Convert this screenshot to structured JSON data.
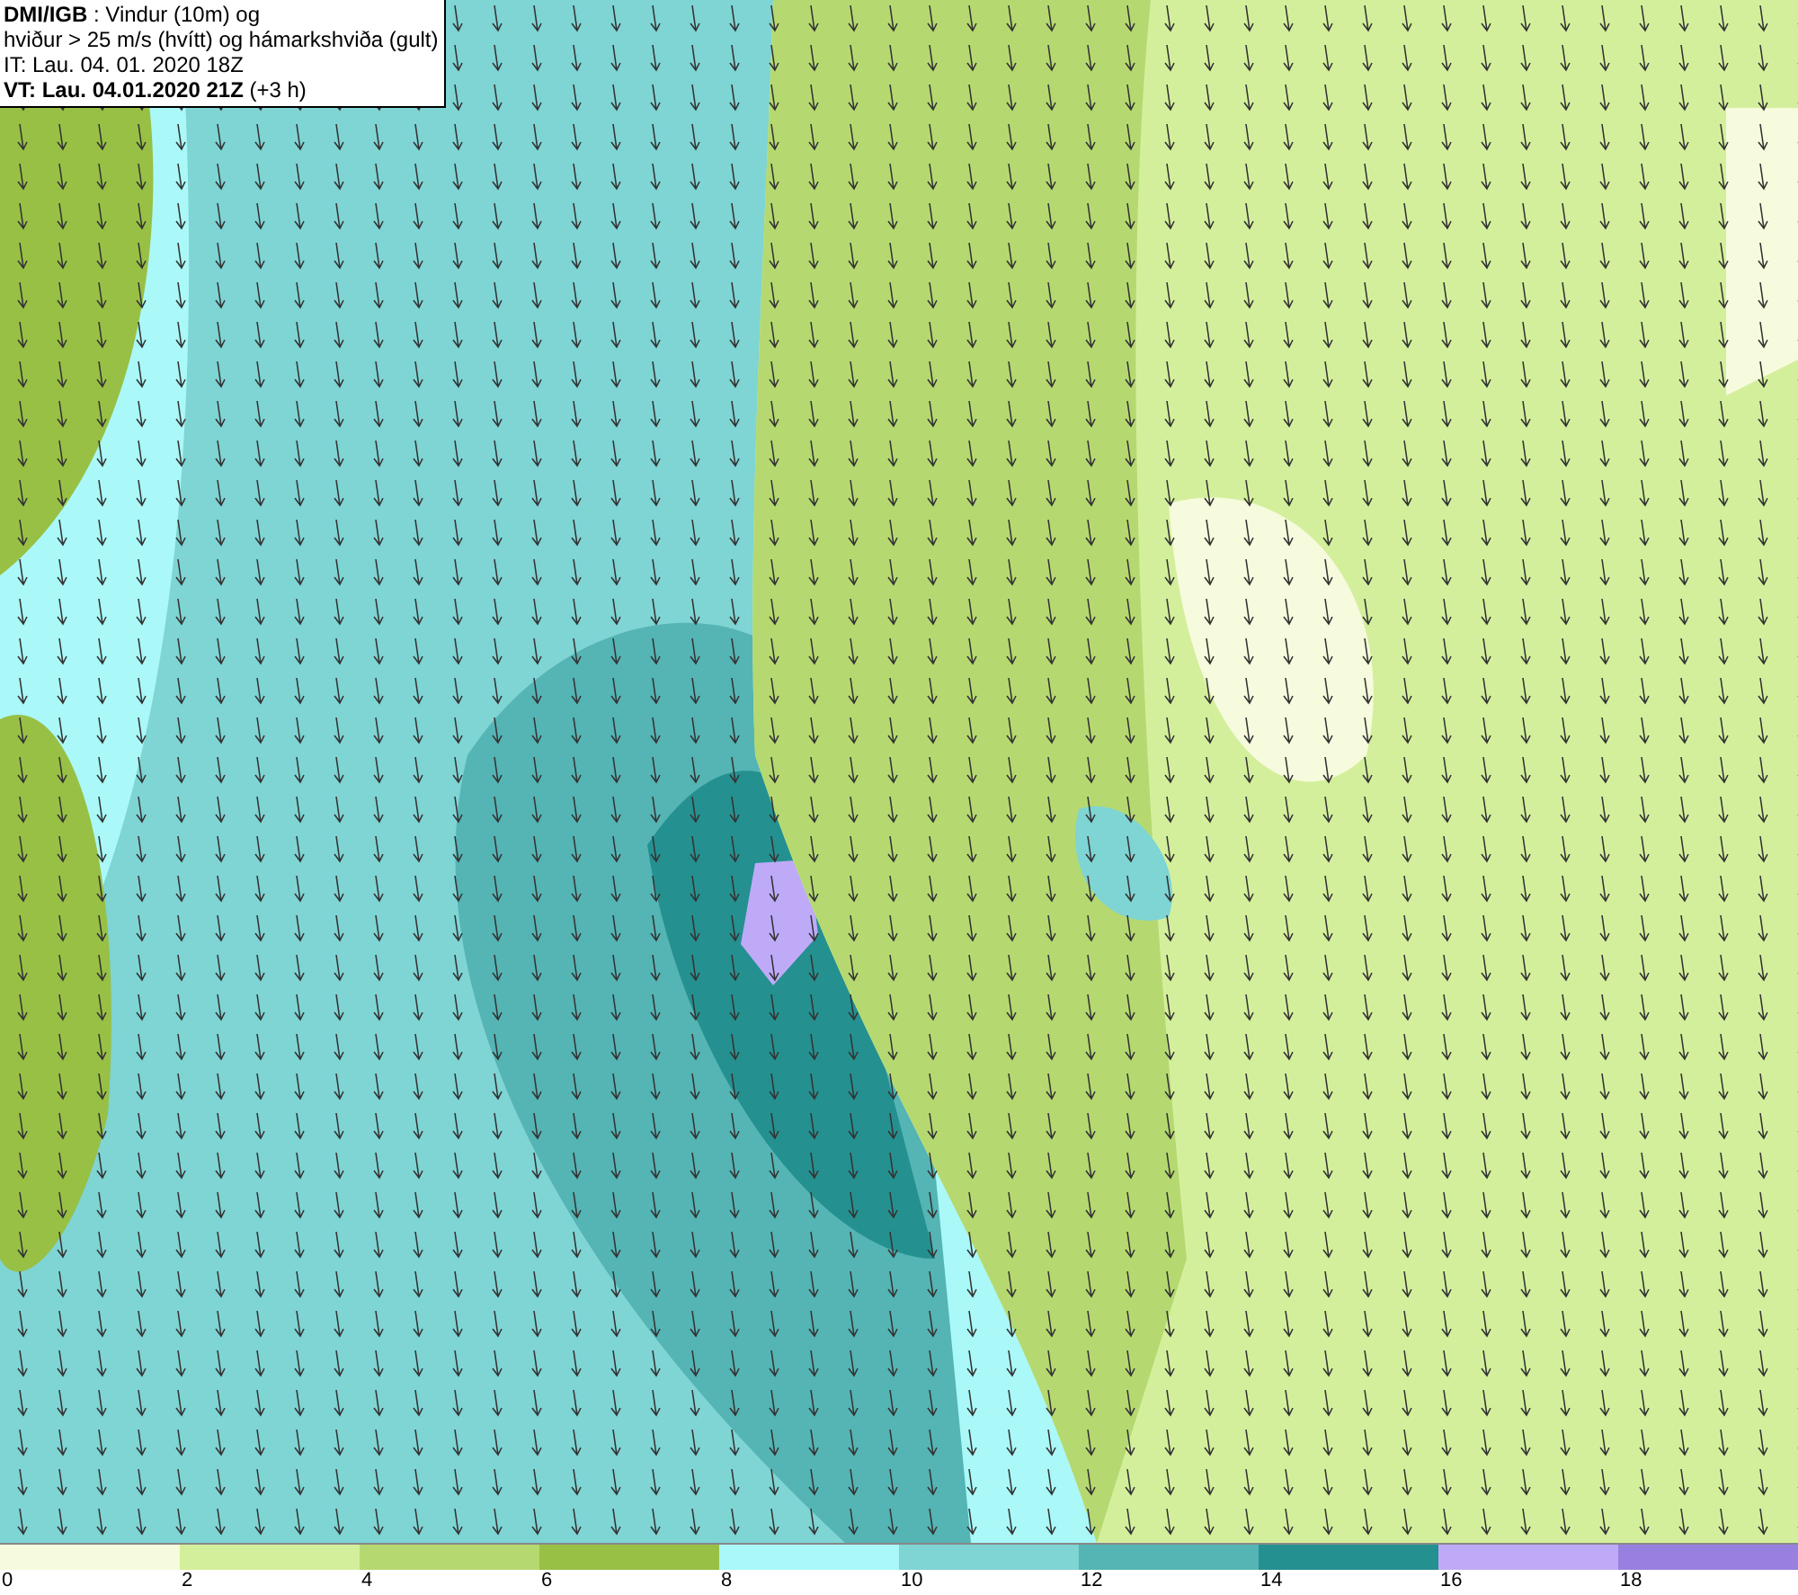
{
  "info_box": {
    "lines": [
      "**DMI/IGB** : Vindur (10m) og",
      "hviður > 25 m/s (hvítt) og hámarkshviða (gult)",
      "IT: Lau. 04. 01. 2020 18Z",
      "**VT: Lau. 04.01.2020 21Z** (+3 h)"
    ]
  },
  "legend": [
    {
      "color": "#f5fbdc",
      "label": "0"
    },
    {
      "color": "#d4ef9c",
      "label": "2"
    },
    {
      "color": "#b5d970",
      "label": "4"
    },
    {
      "color": "#98c045",
      "label": "6"
    },
    {
      "color": "#aaf8f8",
      "label": "8"
    },
    {
      "color": "#7fd4d4",
      "label": "10"
    },
    {
      "color": "#55b4b4",
      "label": "12"
    },
    {
      "color": "#259090",
      "label": "14"
    },
    {
      "color": "#bfaaf8",
      "label": "16"
    },
    {
      "color": "#9880e0",
      "label": "18"
    }
  ]
}
